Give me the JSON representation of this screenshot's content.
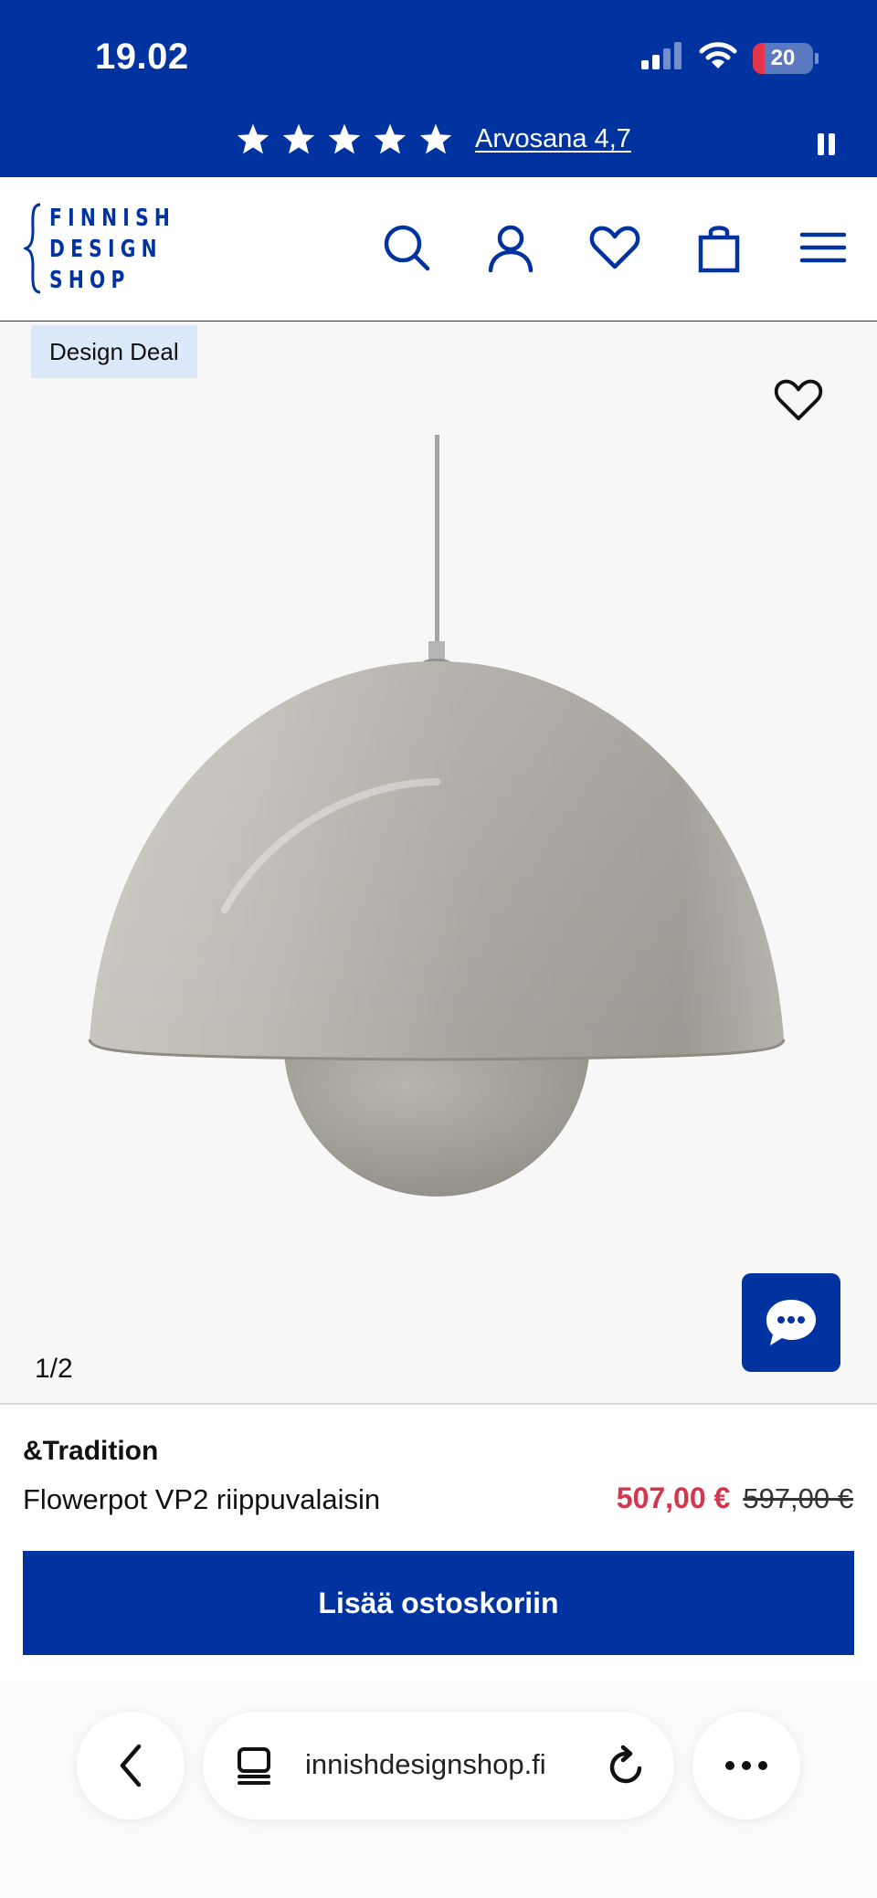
{
  "status": {
    "time": "19.02",
    "battery": "20",
    "battery_level": 0.2,
    "battery_color": "#e5334b"
  },
  "rating_bar": {
    "stars": 5,
    "link_text": "Arvosana 4,7"
  },
  "header": {
    "logo_lines": [
      "FINNISH",
      "DESIGN",
      "SHOP"
    ],
    "icons": [
      "search-icon",
      "account-icon",
      "wishlist-icon",
      "cart-icon",
      "menu-icon"
    ]
  },
  "product": {
    "badge": "Design Deal",
    "image_counter": "1/2",
    "brand": "&Tradition",
    "name": "Flowerpot VP2 riippuvalaisin",
    "price_sale": "507,00 €",
    "price_original": "597,00 €",
    "add_to_cart_label": "Lisää ostoskoriin"
  },
  "browser": {
    "url": "innishdesignshop.fi"
  },
  "colors": {
    "brand_blue": "#0033a0",
    "sale_red": "#d1384e",
    "badge_bg": "#dbe9f9"
  }
}
